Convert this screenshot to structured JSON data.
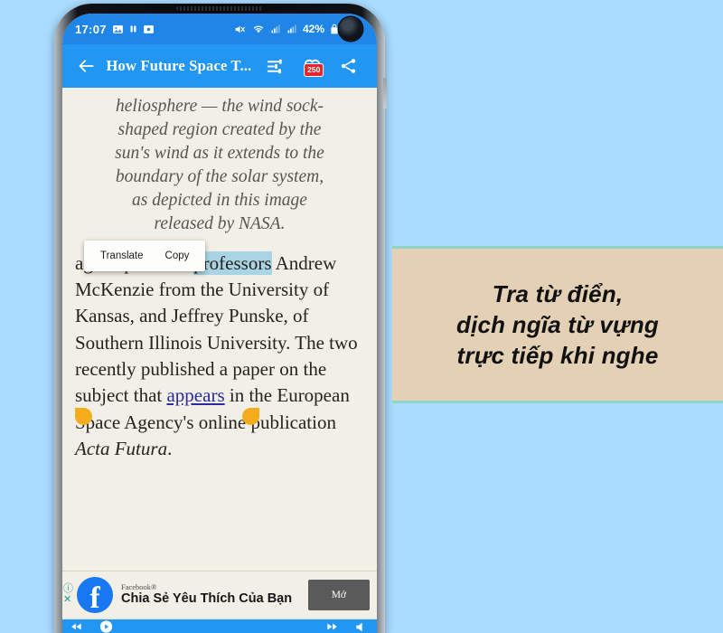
{
  "background_color": "#a9dcff",
  "phone": {
    "status_bar": {
      "time": "17:07",
      "icons_left": [
        "image-icon",
        "pause-icon",
        "screen-record-icon"
      ],
      "icons_right": [
        "mute-icon",
        "wifi-icon",
        "signal-icon",
        "signal-icon"
      ],
      "battery": "42%",
      "battery_icon": "battery-lock-icon",
      "background_color": "#1f86e8"
    },
    "toolbar": {
      "back_label": "back-arrow",
      "title": "How Future Space T...",
      "settings_label": "settings-sliders",
      "favorite_count": "250",
      "share_label": "share",
      "background_color": "#2196f3"
    },
    "article": {
      "caption_lines": [
        "heliosphere — the wind sock-",
        "shaped region created by the",
        "sun's wind as it extends to the",
        "boundary of the solar system,",
        "as depicted in this image",
        "released by NASA."
      ],
      "paragraph": {
        "before_highlight": "age experts are ",
        "highlighted_word": "professors",
        "after_highlight": " Andrew McKenzie from the University of Kansas, and Jeffrey Punske, of Southern Illinois University. The two recently published a paper on the subject that ",
        "link_text": "appears",
        "after_link": " in the European Space Agency's online publication ",
        "italic_title": "Acta Futura",
        "end": "."
      },
      "highlight_color": "#a9d4e4",
      "handle_color": "#f5ac1c",
      "link_color": "#2b2b9e",
      "background_color": "#f2efe6"
    },
    "context_menu": {
      "translate_label": "Translate",
      "copy_label": "Copy"
    },
    "ad": {
      "brand": "Facebook®",
      "title": "Chia Sẻ Yêu Thích Của Bạn",
      "button_label": "Mở",
      "logo_glyph": "f",
      "info_glyph": "ⓘ",
      "close_glyph": "✕",
      "brand_color": "#1877f2"
    },
    "player": {
      "left_label": "",
      "right_label": ""
    }
  },
  "side_panel": {
    "lines": [
      "Tra từ điển,",
      "dịch ngĩa từ vựng",
      "trực tiếp khi nghe"
    ],
    "background_color": "#e3d0b5",
    "border_color": "#8fd4c6"
  }
}
